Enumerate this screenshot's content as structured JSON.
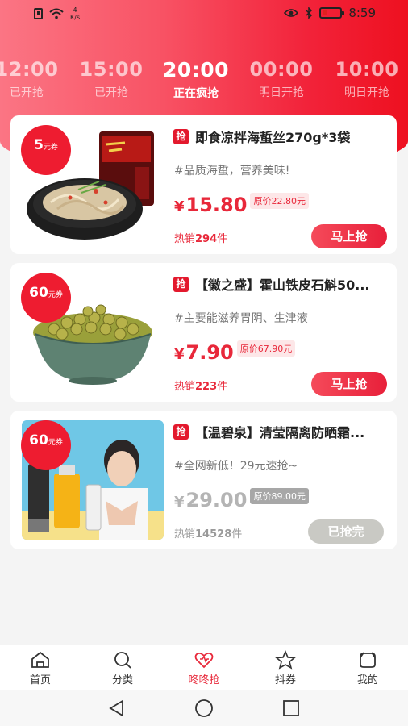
{
  "status_bar": {
    "net_speed_value": "4",
    "net_speed_unit": "K/s",
    "time": "8:59"
  },
  "time_tabs": [
    {
      "time": "12:00",
      "status": "已开抢"
    },
    {
      "time": "15:00",
      "status": "已开抢"
    },
    {
      "time": "20:00",
      "status": "正在疯抢"
    },
    {
      "time": "00:00",
      "status": "明日开抢"
    },
    {
      "time": "10:00",
      "status": "明日开抢"
    }
  ],
  "products": [
    {
      "coupon_value": "5",
      "coupon_unit": "元券",
      "badge": "抢",
      "title": "即食凉拌海蜇丝270g*3袋",
      "desc": "#品质海蜇，营养美味!",
      "currency": "¥",
      "price": "15.80",
      "original_price": "原价22.80元",
      "sold_label": "热销",
      "sold_count": "294",
      "sold_unit": "件",
      "button": "马上抢"
    },
    {
      "coupon_value": "60",
      "coupon_unit": "元券",
      "badge": "抢",
      "title": "【徽之盛】霍山铁皮石斛50...",
      "desc": "#主要能滋养胃阴、生津液",
      "currency": "¥",
      "price": "7.90",
      "original_price": "原价67.90元",
      "sold_label": "热销",
      "sold_count": "223",
      "sold_unit": "件",
      "button": "马上抢"
    },
    {
      "coupon_value": "60",
      "coupon_unit": "元券",
      "badge": "抢",
      "title": "【温碧泉】清莹隔离防晒霜...",
      "desc": "#全网新低！29元速抢~",
      "currency": "¥",
      "price": "29.00",
      "original_price": "原价89.00元",
      "sold_label": "热销",
      "sold_count": "14528",
      "sold_unit": "件",
      "button": "已抢完"
    }
  ],
  "bottom_nav": [
    {
      "label": "首页",
      "icon": "home-icon"
    },
    {
      "label": "分类",
      "icon": "search-icon"
    },
    {
      "label": "咚咚抢",
      "icon": "heart-icon"
    },
    {
      "label": "抖券",
      "icon": "star-icon"
    },
    {
      "label": "我的",
      "icon": "profile-icon"
    }
  ],
  "colors": {
    "accent": "#e8283a",
    "header_gradient_start": "#fb7584",
    "header_gradient_end": "#ee1020",
    "soldout_button": "#c9c9c4"
  }
}
